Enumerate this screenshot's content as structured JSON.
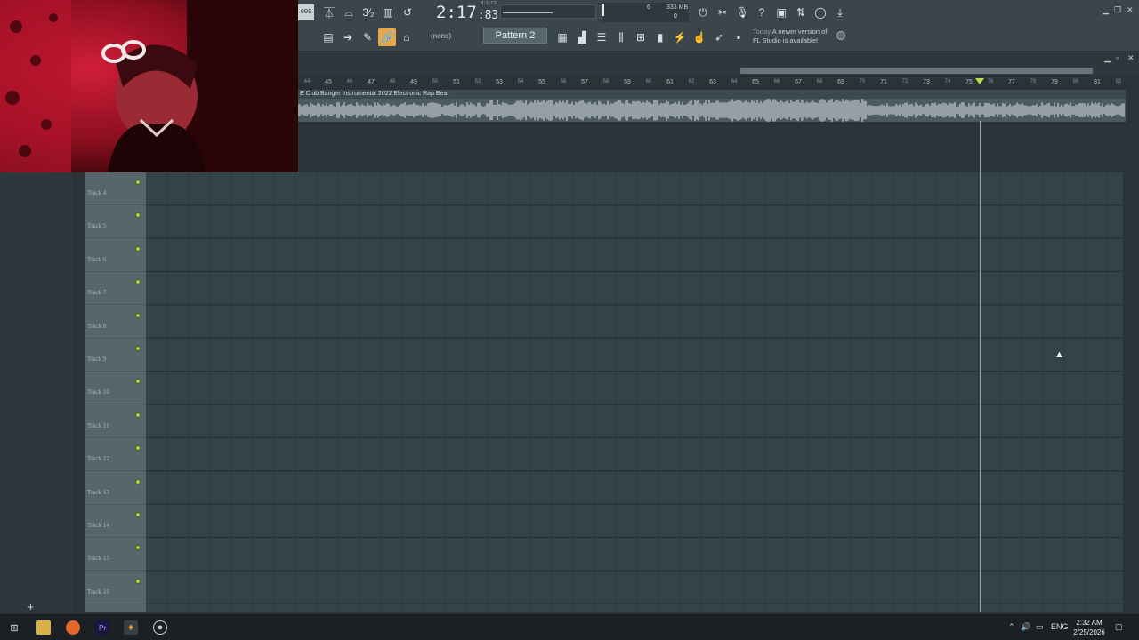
{
  "toolbar": {
    "tempo": "000",
    "time_main": "2:17",
    "time_sub": "83",
    "time_label": "M:S:CS",
    "meter_cpu": "6",
    "meter_mem": "333 MB",
    "meter_poly": "0",
    "pattern_selector": "(none)",
    "pattern_name": "Pattern 2",
    "news_date": "Today",
    "news_text_1": "A newer version of",
    "news_text_2": "FL Studio is available!"
  },
  "playlist": {
    "ruler": [
      "44",
      "45",
      "46",
      "47",
      "48",
      "49",
      "50",
      "51",
      "52",
      "53",
      "54",
      "55",
      "56",
      "57",
      "58",
      "59",
      "60",
      "61",
      "62",
      "63",
      "64",
      "65",
      "66",
      "67",
      "68",
      "69",
      "70",
      "71",
      "72",
      "73",
      "74",
      "75",
      "76",
      "77",
      "78",
      "79",
      "80",
      "81",
      "82"
    ],
    "audio_clip_title": "E  Club Banger Instrumental 2022  Electronic Rap Beat",
    "tracks": [
      "Track 4",
      "Track 5",
      "Track 6",
      "Track 7",
      "Track 8",
      "Track 9",
      "Track 10",
      "Track 11",
      "Track 12",
      "Track 13",
      "Track 14",
      "Track 15",
      "Track 16"
    ]
  },
  "taskbar": {
    "language": "ENG",
    "time": "2:32 AM",
    "date": "2/25/2026"
  },
  "colors": {
    "accent": "#e8a84a",
    "track_indicator": "#9fd44a",
    "playhead": "#b8e04a"
  }
}
